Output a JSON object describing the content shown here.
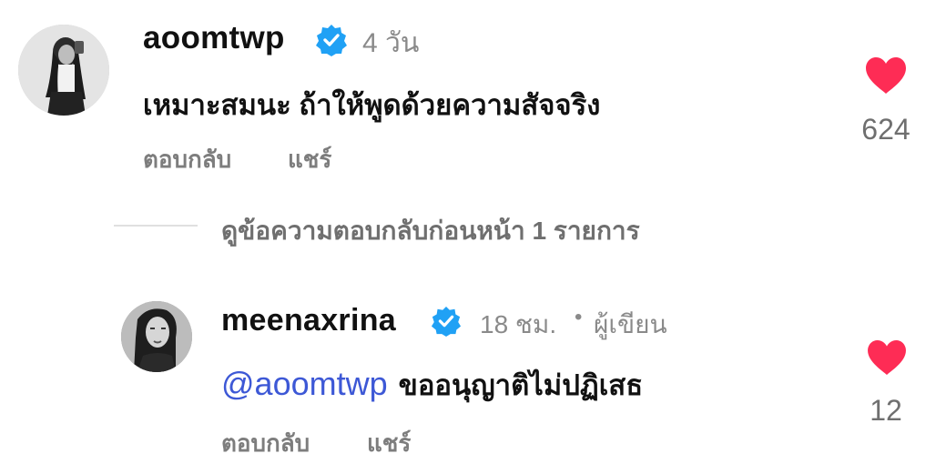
{
  "comment": {
    "username": "aoomtwp",
    "verified_icon": "verified-badge-icon",
    "time": "4 วัน",
    "text": "เหมาะสมนะ ถ้าให้พูดด้วยความสัจจริง",
    "reply_label": "ตอบกลับ",
    "share_label": "แชร์",
    "like_count": "624",
    "like_icon": "heart-icon",
    "like_color": "#fe2c55"
  },
  "view_replies": {
    "label": "ดูข้อความตอบกลับก่อนหน้า 1 รายการ"
  },
  "reply": {
    "username": "meenaxrina",
    "verified_icon": "verified-badge-icon",
    "time": "18 ชม.",
    "separator": "•",
    "author_tag": "ผู้เขียน",
    "mention": "@aoomtwp",
    "text": "ขออนุญาติไม่ปฏิเสธ",
    "reply_label": "ตอบกลับ",
    "share_label": "แชร์",
    "like_count": "12",
    "like_icon": "heart-icon",
    "like_color": "#fe2c55"
  },
  "colors": {
    "verified": "#20a1f5",
    "mention": "#3d58d6",
    "muted": "#8a8a8a"
  }
}
